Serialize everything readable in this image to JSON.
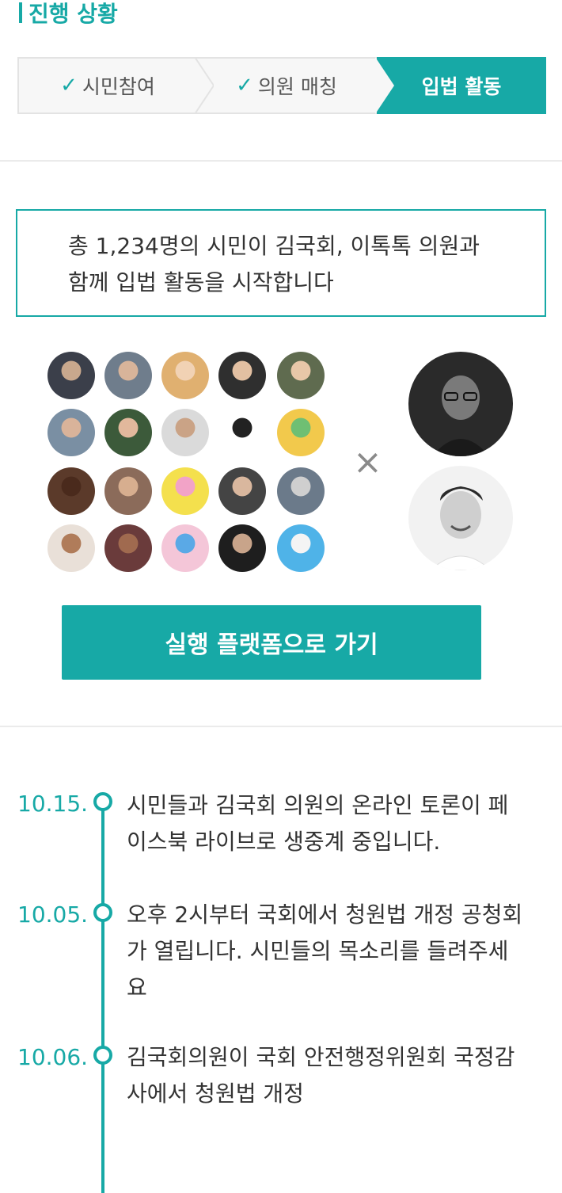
{
  "header": {
    "title": "진행 상황"
  },
  "steps": [
    {
      "label": "시민참여",
      "done": true
    },
    {
      "label": "의원 매칭",
      "done": true
    },
    {
      "label": "입법 활동",
      "active": true
    }
  ],
  "notice": {
    "line1": "총 1,234명의 시민이 김국회, 이톡톡 의원과",
    "line2": "함께 입법 활동을 시작합니다"
  },
  "citizens_icon": "citizen-avatars",
  "cross_symbol": "×",
  "cta": {
    "label": "실행 플랫폼으로 가기"
  },
  "timeline": [
    {
      "date": "10.15.",
      "lines": [
        "시민들과 김국회 의원의 온라인 토론이 페",
        "이스북 라이브로 생중계 중입니다."
      ]
    },
    {
      "date": "10.05.",
      "lines": [
        "오후 2시부터 국회에서 청원법 개정 공청회",
        "가 열립니다. 시민들의 목소리를 들려주세",
        "요"
      ]
    },
    {
      "date": "10.06.",
      "lines": [
        "김국회의원이 국회 안전행정위원회 국정감",
        "사에서 청원법 개정"
      ]
    }
  ],
  "colors": {
    "accent": "#17a9a6",
    "muted_bg": "#f7f7f7",
    "border": "#e3e3e3"
  }
}
